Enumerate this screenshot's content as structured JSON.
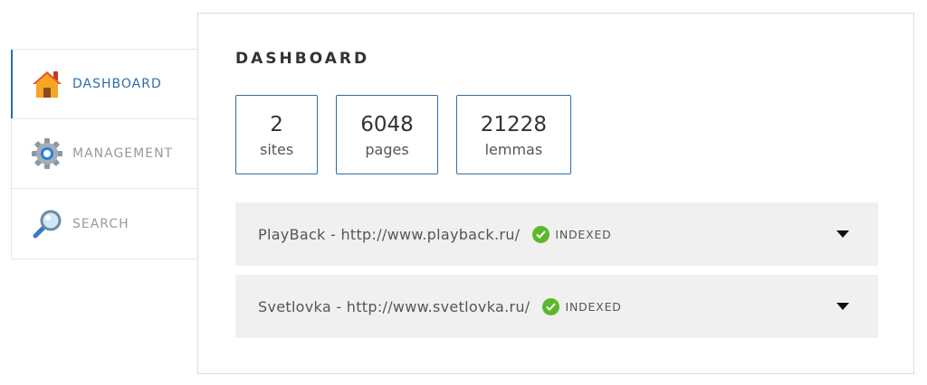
{
  "sidebar": {
    "items": [
      {
        "label": "DASHBOARD",
        "icon": "house-icon",
        "active": true
      },
      {
        "label": "MANAGEMENT",
        "icon": "gear-icon",
        "active": false
      },
      {
        "label": "SEARCH",
        "icon": "magnifier-icon",
        "active": false
      }
    ]
  },
  "main": {
    "title": "DASHBOARD",
    "stats": [
      {
        "value": "2",
        "label": "sites"
      },
      {
        "value": "6048",
        "label": "pages"
      },
      {
        "value": "21228",
        "label": "lemmas"
      }
    ],
    "sites": [
      {
        "name": "PlayBack - http://www.playback.ru/",
        "status": "INDEXED"
      },
      {
        "name": "Svetlovka - http://www.svetlovka.ru/",
        "status": "INDEXED"
      }
    ]
  },
  "colors": {
    "accent": "#2f6ea5",
    "status_ok": "#5cb82a",
    "row_bg": "#f0f0f0"
  }
}
